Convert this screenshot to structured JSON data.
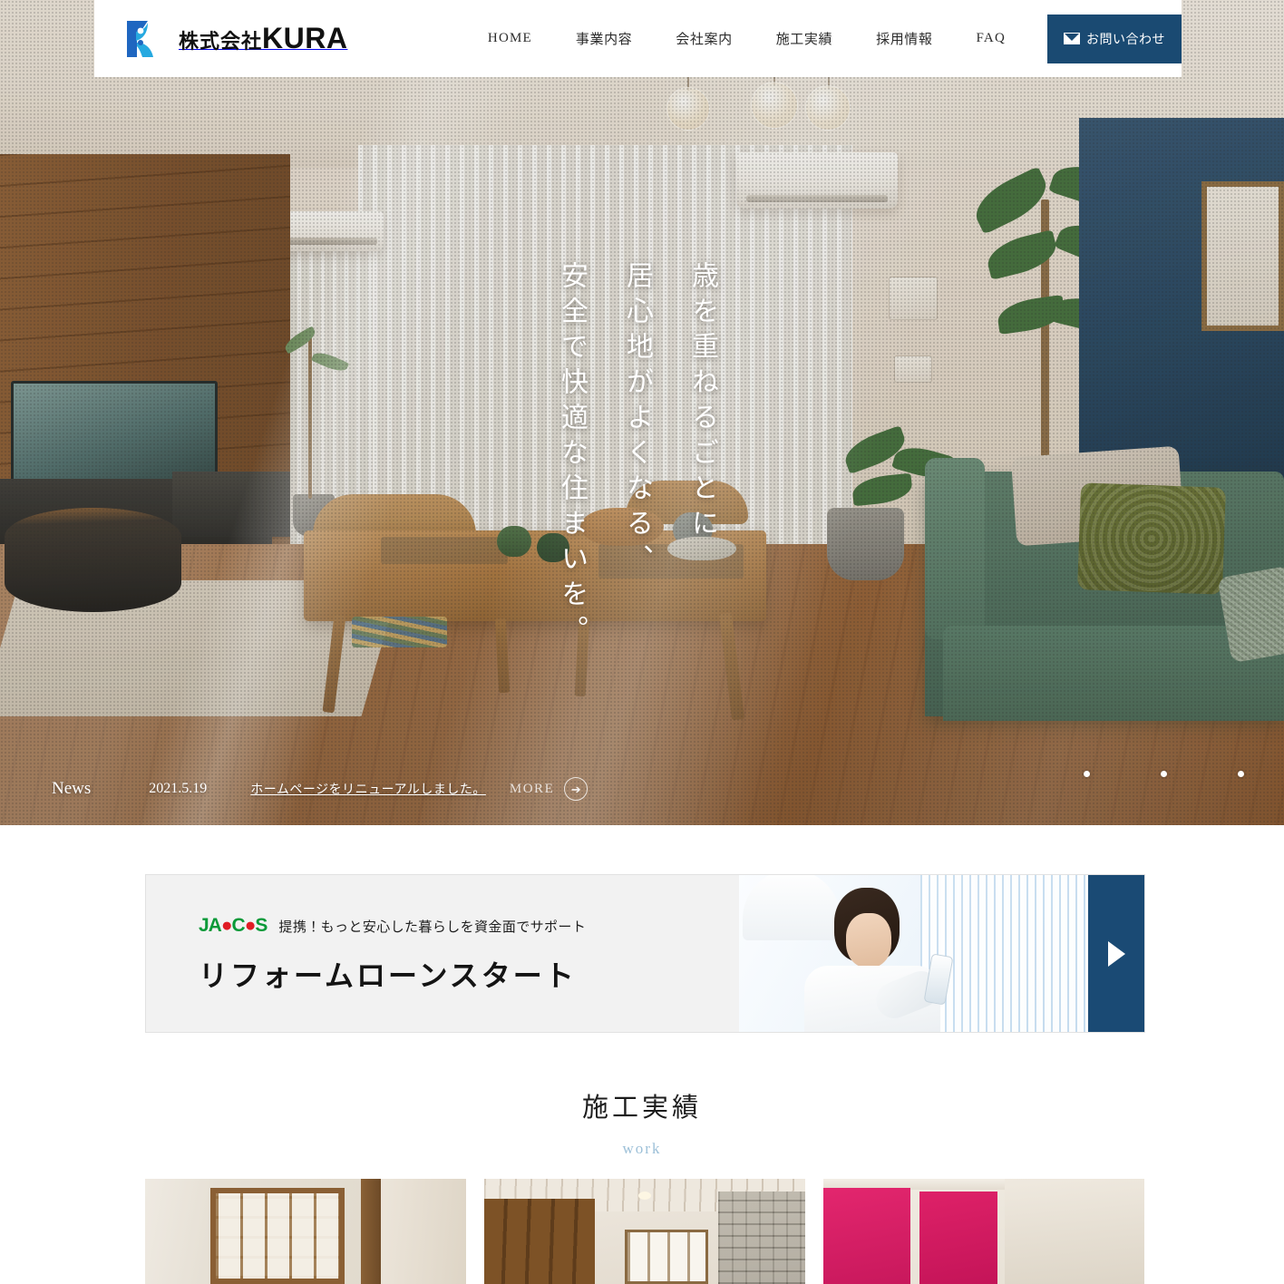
{
  "site": {
    "company_jp": "株式会社",
    "company_en": "KURA",
    "logo_icon": "kura-k-logo"
  },
  "nav": {
    "items": [
      {
        "label": "HOME",
        "latin": true
      },
      {
        "label": "事業内容",
        "latin": false
      },
      {
        "label": "会社案内",
        "latin": false
      },
      {
        "label": "施工実績",
        "latin": false
      },
      {
        "label": "採用情報",
        "latin": false
      },
      {
        "label": "FAQ",
        "latin": true
      }
    ],
    "contact_label": "お問い合わせ",
    "contact_icon": "mail-icon",
    "contact_bg": "#1a4a72"
  },
  "hero": {
    "catchcopy_lines": [
      "歳を重ねるごとに",
      "居心地がよくなる、",
      "安全で快適な住まいを。"
    ],
    "news": {
      "label": "News",
      "date": "2021.5.19",
      "text": "ホームページをリニューアルしました。",
      "more_label": "MORE",
      "more_icon": "arrow-right-circle-icon"
    },
    "slider_dots": 3
  },
  "banner": {
    "brand": "JACCS",
    "subtitle": "提携！もっと安心した暮らしを資金面でサポート",
    "title": "リフォームローンスタート",
    "arrow_icon": "play-triangle-icon",
    "arrow_bg": "#1a4a74",
    "brand_color": "#0a9938",
    "brand_accent": "#e01b24"
  },
  "work": {
    "title": "施工実績",
    "subtitle": "work",
    "subtitle_color": "#9dc0d8",
    "cards": [
      {
        "alt": "和室の障子とふすまの施工事例"
      },
      {
        "alt": "廊下と石壁クロスの施工事例"
      },
      {
        "alt": "ピンクのドアの施工事例"
      }
    ]
  }
}
